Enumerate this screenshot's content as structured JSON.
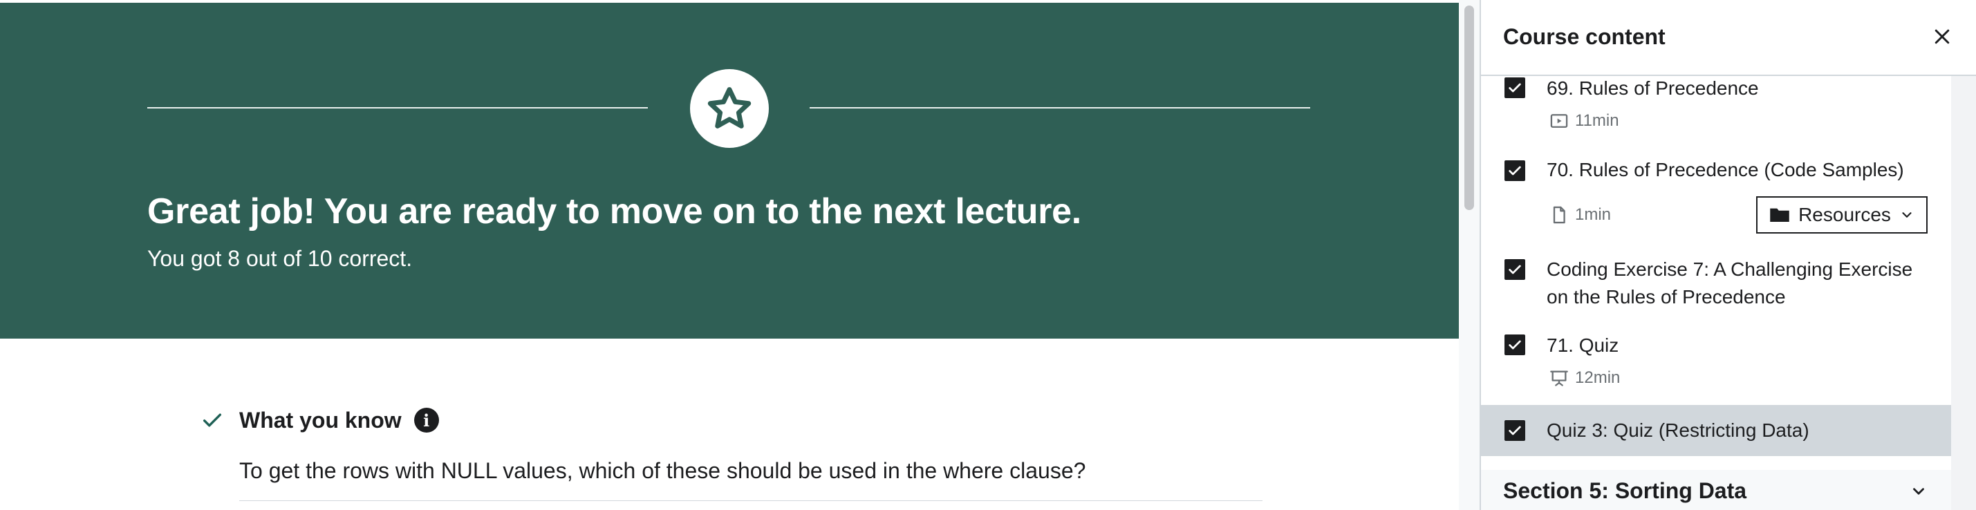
{
  "banner": {
    "title": "Great job! You are ready to move on to the next lecture.",
    "subtitle": "You got 8 out of 10 correct."
  },
  "colors": {
    "banner_bg": "#2f5f55",
    "check_green": "#1e6055",
    "active_item_bg": "#d1d7dc"
  },
  "feedback": {
    "section_title": "What you know",
    "question": "To get the rows with NULL values, which of these should be used in the where clause?"
  },
  "sidebar": {
    "title": "Course content",
    "items": [
      {
        "title": "69. Rules of Precedence",
        "meta": "11min",
        "icon": "video-icon",
        "completed": true
      },
      {
        "title": "70. Rules of Precedence (Code Samples)",
        "meta": "1min",
        "icon": "file-icon",
        "completed": true,
        "resources_label": "Resources"
      },
      {
        "title": "Coding Exercise 7: A Challenging Exercise on the Rules of Precedence",
        "completed": true
      },
      {
        "title": "71. Quiz",
        "meta": "12min",
        "icon": "presentation-icon",
        "completed": true
      },
      {
        "title": "Quiz 3: Quiz (Restricting Data)",
        "completed": true,
        "active": true
      }
    ],
    "next_section": "Section 5: Sorting Data"
  }
}
